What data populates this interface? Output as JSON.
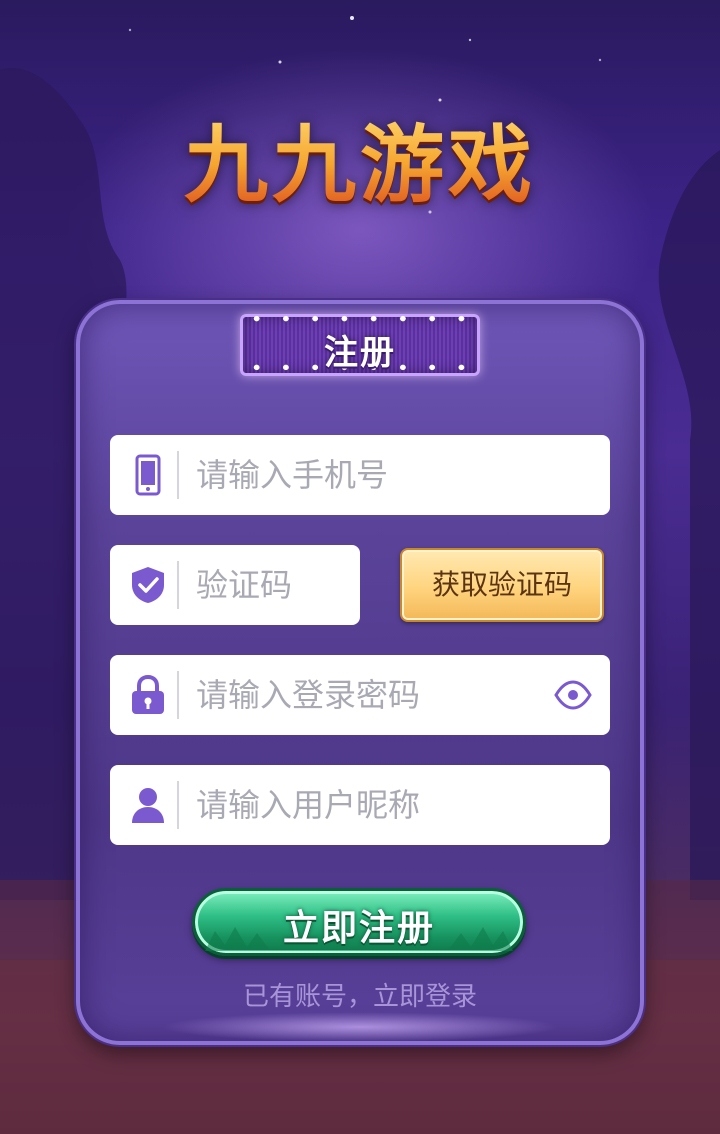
{
  "app": {
    "logo_text": "九九游戏"
  },
  "panel": {
    "title": "注册"
  },
  "form": {
    "phone": {
      "placeholder": "请输入手机号",
      "icon": "phone-icon"
    },
    "code": {
      "placeholder": "验证码",
      "icon": "shield-check-icon"
    },
    "get_code_label": "获取验证码",
    "password": {
      "placeholder": "请输入登录密码",
      "icon": "lock-icon",
      "toggle_icon": "eye-icon"
    },
    "nickname": {
      "placeholder": "请输入用户昵称",
      "icon": "user-icon"
    },
    "submit_label": "立即注册",
    "login_link": "已有账号，立即登录"
  },
  "colors": {
    "accent_purple": "#7b5ad0",
    "button_green": "#2fbf86",
    "button_gold": "#ffd47e",
    "logo_orange": "#f6a530"
  }
}
